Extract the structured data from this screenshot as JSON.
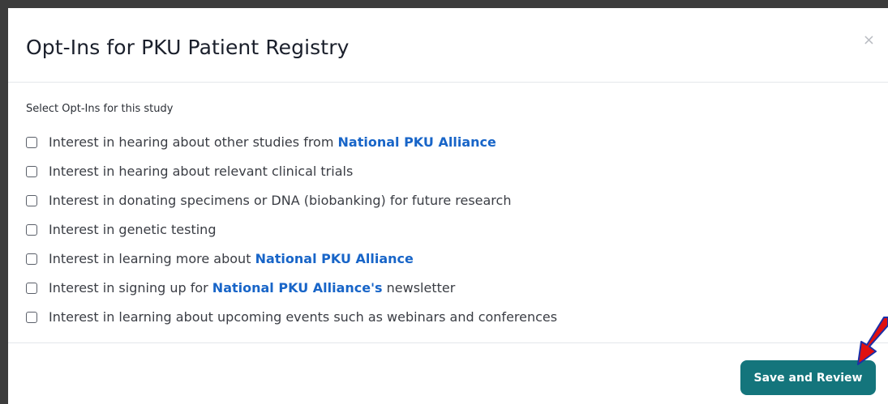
{
  "modal": {
    "title": "Opt-Ins for PKU Patient Registry",
    "close_symbol": "×",
    "section_label": "Select Opt-Ins for this study",
    "save_button_label": "Save and Review",
    "optins": [
      {
        "pre": "Interest in hearing about other studies from ",
        "link": "National PKU Alliance",
        "post": ""
      },
      {
        "pre": "Interest in hearing about relevant clinical trials",
        "link": "",
        "post": ""
      },
      {
        "pre": "Interest in donating specimens or DNA (biobanking) for future research",
        "link": "",
        "post": ""
      },
      {
        "pre": "Interest in genetic testing",
        "link": "",
        "post": ""
      },
      {
        "pre": "Interest in learning more about ",
        "link": "National PKU Alliance",
        "post": ""
      },
      {
        "pre": "Interest in signing up for ",
        "link": "National PKU Alliance's",
        "post": " newsletter"
      },
      {
        "pre": "Interest in learning about upcoming events such as webinars and conferences",
        "link": "",
        "post": ""
      }
    ]
  },
  "colors": {
    "backdrop": "#3c3c3c",
    "link": "#1865c8",
    "button": "#14757c",
    "arrow": "#e01010",
    "arrow_outline": "#1a2fa8"
  },
  "icons": {
    "close": "close-icon",
    "arrow": "red-arrow-annotation"
  }
}
